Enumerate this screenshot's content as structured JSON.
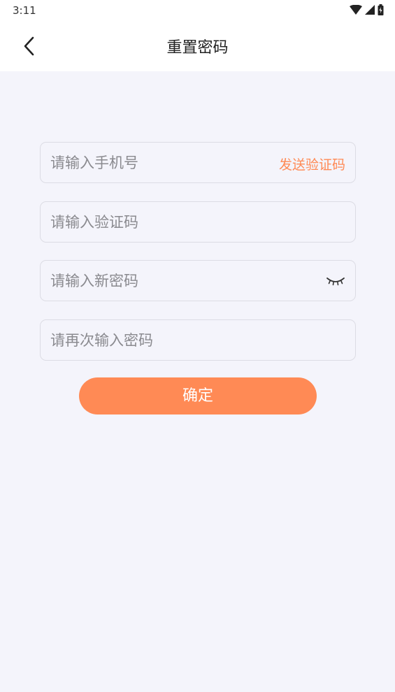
{
  "status": {
    "time": "3:11"
  },
  "header": {
    "title": "重置密码",
    "back_icon": "chevron-left-icon"
  },
  "form": {
    "phone_placeholder": "请输入手机号",
    "send_code_label": "发送验证码",
    "code_placeholder": "请输入验证码",
    "new_password_placeholder": "请输入新密码",
    "confirm_password_placeholder": "请再次输入密码",
    "password_toggle_icon": "eye-closed-icon"
  },
  "actions": {
    "confirm_label": "确定"
  },
  "colors": {
    "accent": "#ff8a55",
    "background": "#f4f4fb",
    "border": "#dcdce4"
  }
}
